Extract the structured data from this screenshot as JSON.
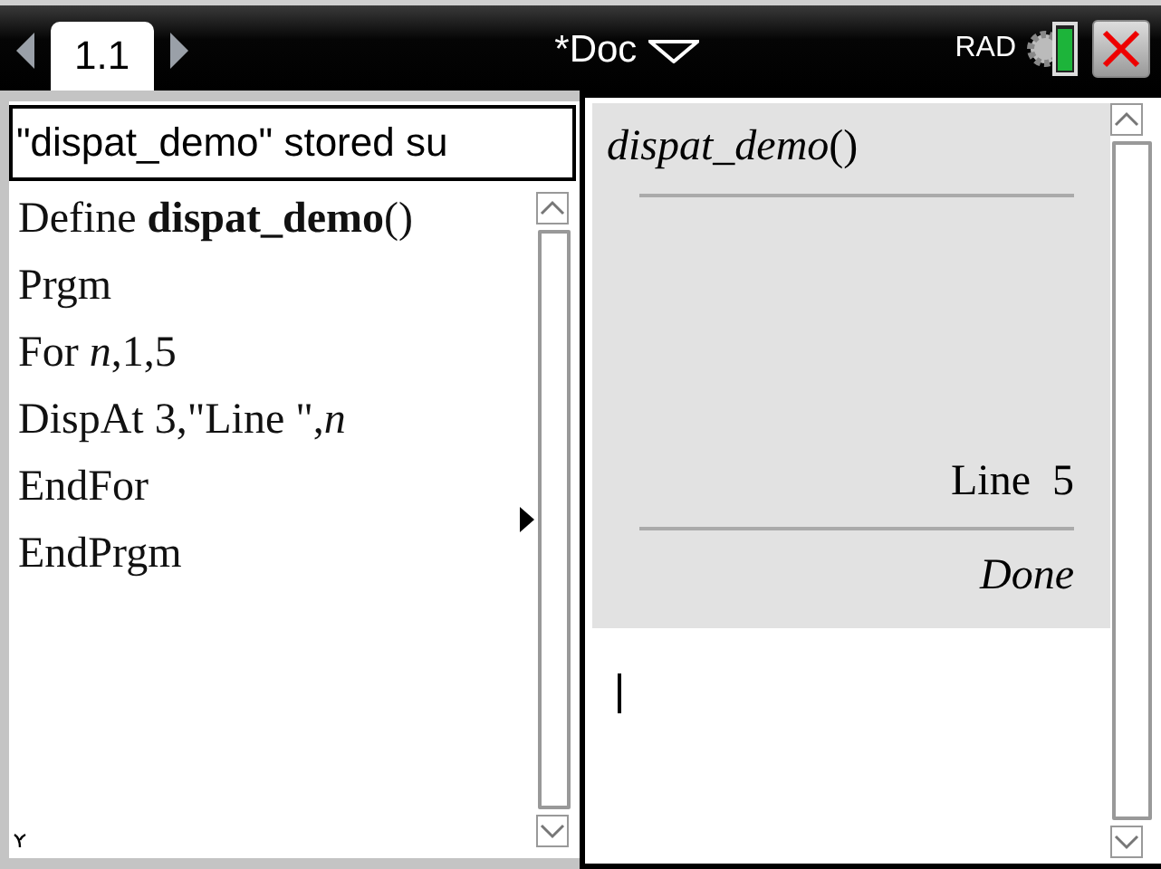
{
  "toolbar": {
    "tabs": [
      {
        "label": "1.1",
        "selected": true
      }
    ],
    "document_title": "*Doc",
    "angle_mode": "RAD"
  },
  "status_message": "\"dispat_demo\" stored su",
  "program_lines": [
    "Define **dispat_demo**()",
    "Prgm",
    "For *n*,1,5",
    "DispAt 3,\"Line \",*n*",
    "EndFor",
    "EndPrgm"
  ],
  "history": [
    {
      "input": "*dispat_demo*()",
      "output_lines": [
        "Line  5"
      ],
      "result": "Done"
    }
  ]
}
